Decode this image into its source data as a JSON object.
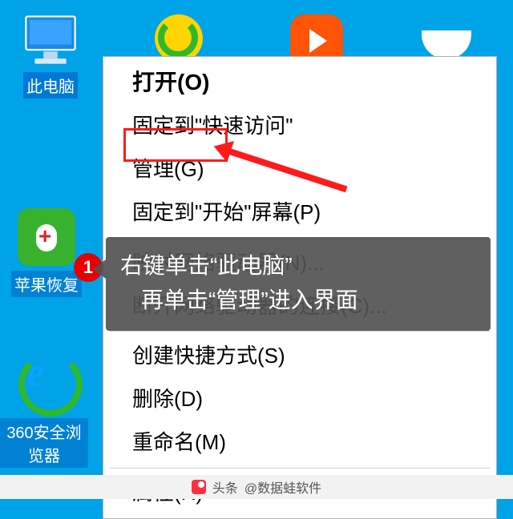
{
  "desktop": {
    "this_pc_label": "此电脑",
    "apple_recovery_label": "苹果恢复",
    "browser_label": "360安全浏览器"
  },
  "context_menu": {
    "open": "打开(O)",
    "pin_quick": "固定到\"快速访问\"",
    "manage": "管理(G)",
    "pin_start": "固定到\"开始\"屏幕(P)",
    "map_drive": "映射网络驱动器(N)...",
    "disconnect_drive": "断开网络驱动器的连接(C)...",
    "create_shortcut": "创建快捷方式(S)",
    "delete": "删除(D)",
    "rename": "重命名(M)",
    "properties": "属性(R)"
  },
  "annotation": {
    "step_number": "1",
    "callout_line1": "右键单击“此电脑”",
    "callout_line2": "再单击“管理”进入界面"
  },
  "footer": {
    "prefix": "头条",
    "handle": "@数据蛙软件"
  }
}
